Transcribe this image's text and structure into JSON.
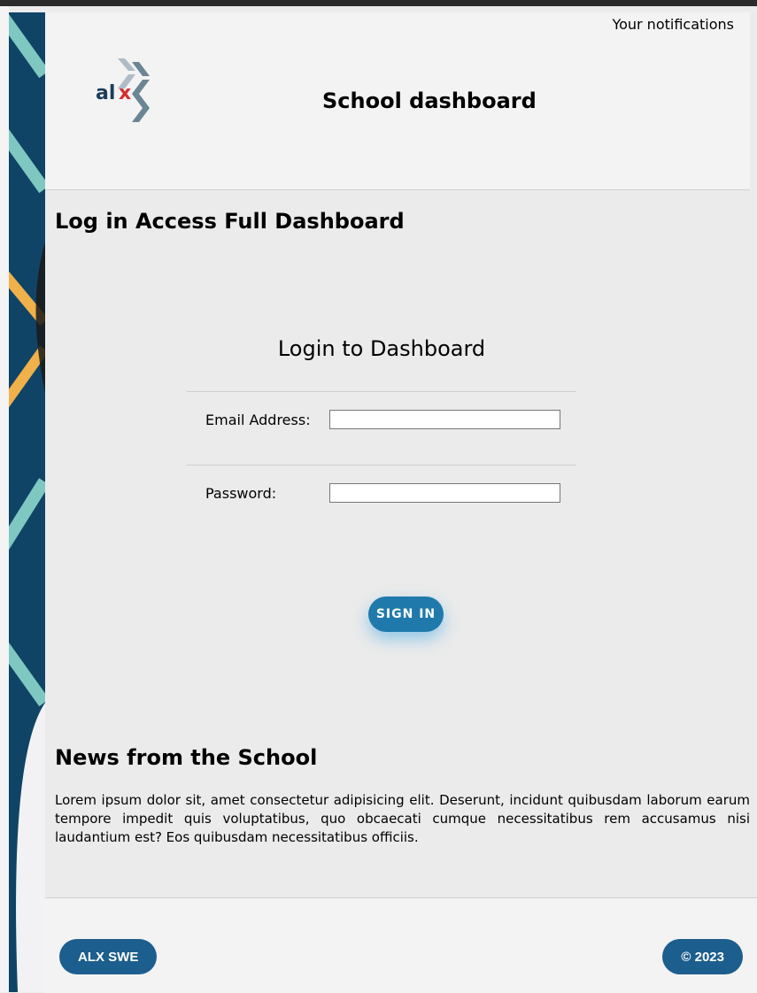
{
  "header": {
    "notifications_label": "Your notifications",
    "title": "School dashboard",
    "logo_text": "alx"
  },
  "login": {
    "heading": "Log in Access Full Dashboard",
    "box_title": "Login to Dashboard",
    "email_label": "Email Address:",
    "email_value": "",
    "password_label": "Password:",
    "password_value": "",
    "sign_in_label": "SIGN IN"
  },
  "news": {
    "heading": "News from the School",
    "body": "Lorem ipsum dolor sit, amet consectetur adipisicing elit. Deserunt, incidunt quibusdam laborum earum tempore impedit quis voluptatibus, quo obcaecati cumque necessitatibus rem accusamus nisi laudantium est? Eos quibusdam necessitatibus officiis."
  },
  "footer": {
    "left_label": "ALX SWE",
    "right_label": "© 2023"
  },
  "colors": {
    "brand_dark": "#1c5e8e",
    "button_blue": "#1f7aab",
    "logo_red": "#d62d2d",
    "logo_navy": "#1c3d5a",
    "side_navy": "#0f4466",
    "side_teal": "#7fc8c2",
    "side_orange": "#f0b14a"
  }
}
